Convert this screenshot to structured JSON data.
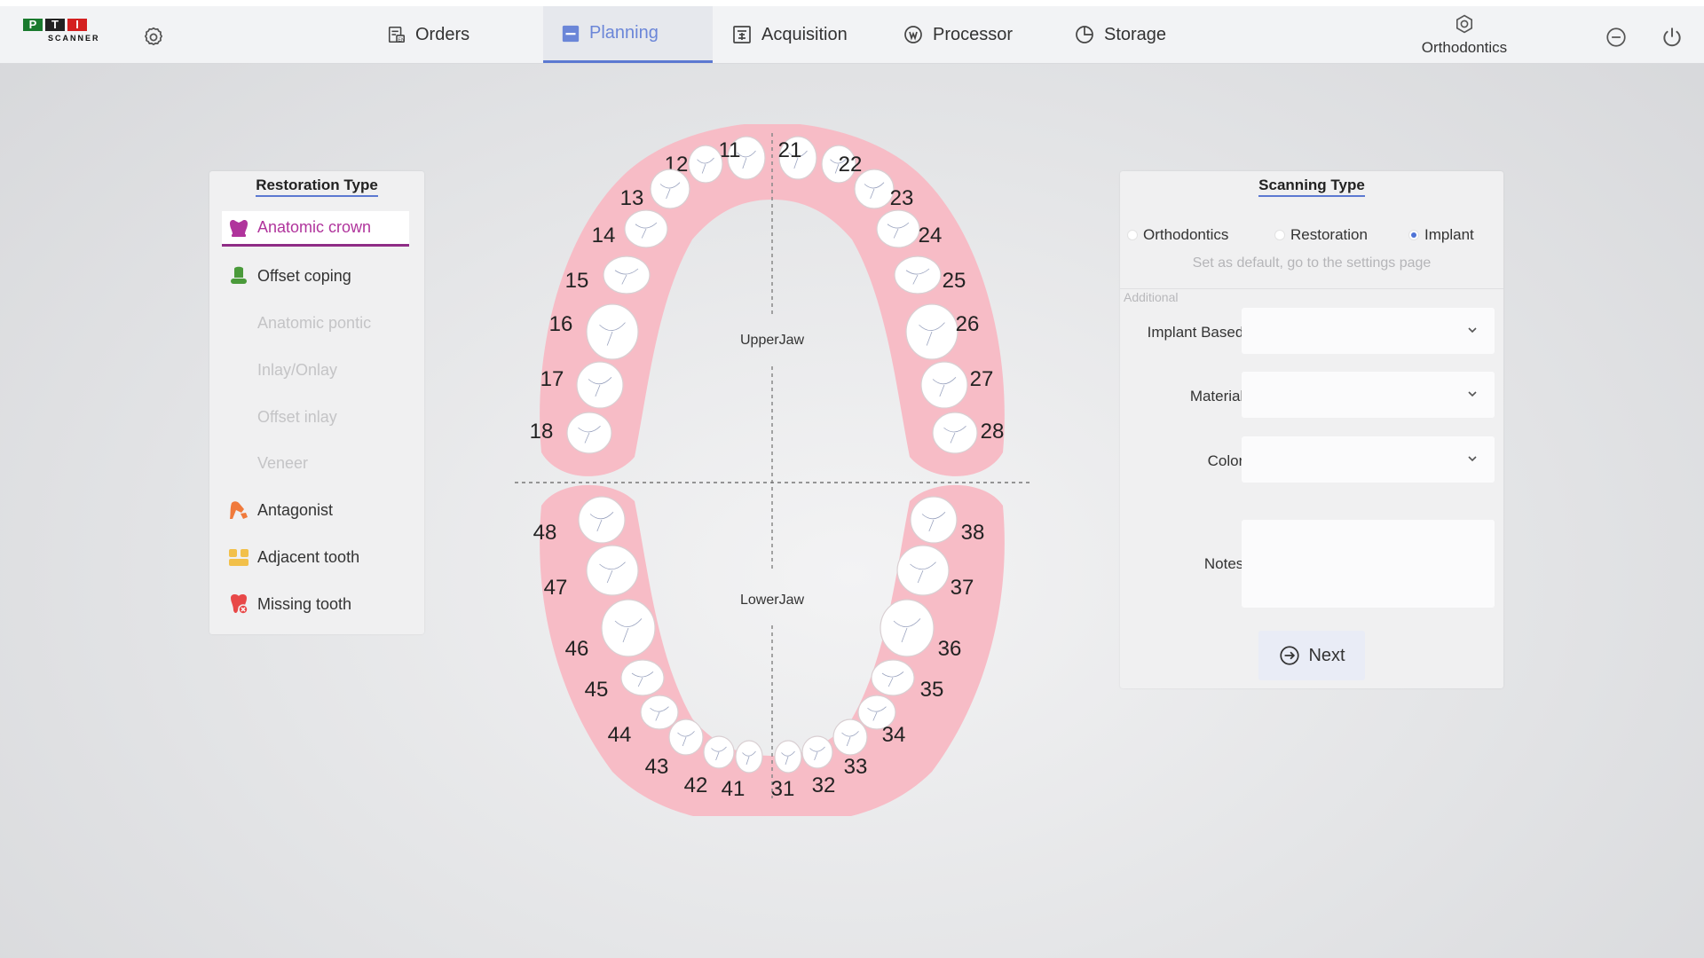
{
  "header": {
    "logo": {
      "top": "PTI",
      "bottom": "SCANNER"
    },
    "tabs": [
      {
        "label": "Orders",
        "icon": "orders-icon",
        "active": false
      },
      {
        "label": "Planning",
        "icon": "planning-icon",
        "active": true
      },
      {
        "label": "Acquisition",
        "icon": "acquisition-icon",
        "active": false
      },
      {
        "label": "Processor",
        "icon": "processor-icon",
        "active": false
      },
      {
        "label": "Storage",
        "icon": "storage-icon",
        "active": false
      }
    ],
    "mode_label": "Orthodontics",
    "accent_color": "#5c79d1"
  },
  "restoration": {
    "title": "Restoration Type",
    "items": [
      {
        "label": "Anatomic crown",
        "state": "active",
        "color": "#b0349c"
      },
      {
        "label": "Offset coping",
        "state": "enabled",
        "color": "#4a9a3a"
      },
      {
        "label": "Anatomic pontic",
        "state": "disabled"
      },
      {
        "label": "Inlay/Onlay",
        "state": "disabled"
      },
      {
        "label": "Offset inlay",
        "state": "disabled"
      },
      {
        "label": "Veneer",
        "state": "disabled"
      },
      {
        "label": "Antagonist",
        "state": "enabled",
        "color": "#f07a3c"
      },
      {
        "label": "Adjacent tooth",
        "state": "enabled",
        "color": "#f2c04a"
      },
      {
        "label": "Missing tooth",
        "state": "enabled",
        "color": "#e84848"
      }
    ]
  },
  "tooth_chart": {
    "upper_label": "UpperJaw",
    "lower_label": "LowerJaw",
    "gum_color": "#f7bcc6",
    "upper_teeth": [
      "11",
      "12",
      "13",
      "14",
      "15",
      "16",
      "17",
      "18",
      "21",
      "22",
      "23",
      "24",
      "25",
      "26",
      "27",
      "28"
    ],
    "lower_teeth": [
      "31",
      "32",
      "33",
      "34",
      "35",
      "36",
      "37",
      "38",
      "41",
      "42",
      "43",
      "44",
      "45",
      "46",
      "47",
      "48"
    ]
  },
  "scanning": {
    "title": "Scanning Type",
    "options": [
      {
        "label": "Orthodontics",
        "selected": false
      },
      {
        "label": "Restoration",
        "selected": false
      },
      {
        "label": "Implant",
        "selected": true
      }
    ],
    "hint": "Set as default, go to the settings page",
    "additional_label": "Additional",
    "fields": {
      "implant_based": {
        "label": "Implant Based:",
        "value": ""
      },
      "material": {
        "label": "Material:",
        "value": ""
      },
      "color": {
        "label": "Color:",
        "value": ""
      },
      "notes": {
        "label": "Notes:",
        "value": ""
      }
    },
    "next_label": "Next"
  }
}
